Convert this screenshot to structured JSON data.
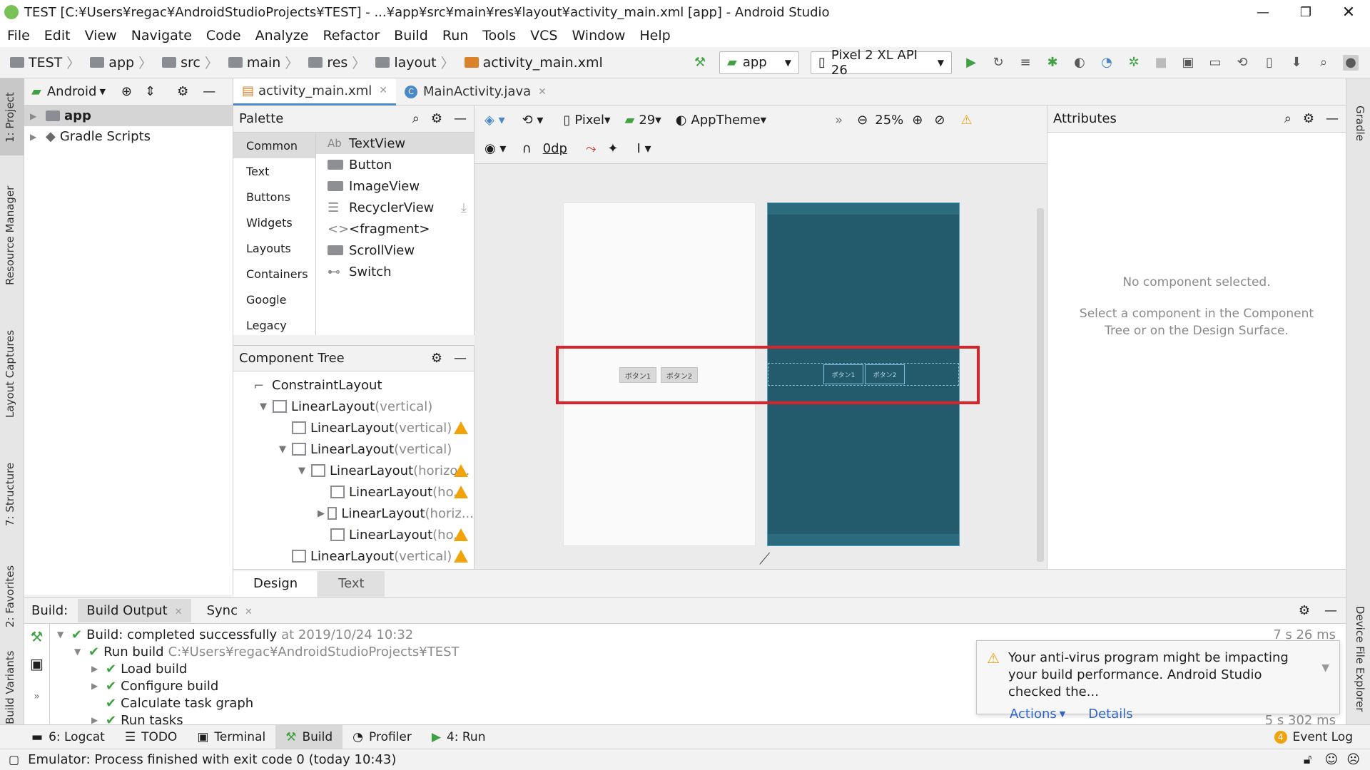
{
  "window": {
    "title": "TEST [C:¥Users¥regac¥AndroidStudioProjects¥TEST] - ...¥app¥src¥main¥res¥layout¥activity_main.xml [app] - Android Studio"
  },
  "menu": [
    "File",
    "Edit",
    "View",
    "Navigate",
    "Code",
    "Analyze",
    "Refactor",
    "Build",
    "Run",
    "Tools",
    "VCS",
    "Window",
    "Help"
  ],
  "breadcrumb": [
    "TEST",
    "app",
    "src",
    "main",
    "res",
    "layout",
    "activity_main.xml"
  ],
  "toolbar": {
    "config": "app",
    "device": "Pixel 2 XL API 26"
  },
  "left_strip": [
    "1: Project",
    "Resource Manager",
    "Layout Captures",
    "7: Structure",
    "2: Favorites",
    "Build Variants"
  ],
  "right_strip": [
    "Gradle",
    "Device File Explorer"
  ],
  "project": {
    "view": "Android",
    "items": [
      "app",
      "Gradle Scripts"
    ]
  },
  "editor_tabs": [
    "activity_main.xml",
    "MainActivity.java"
  ],
  "palette": {
    "title": "Palette",
    "categories": [
      "Common",
      "Text",
      "Buttons",
      "Widgets",
      "Layouts",
      "Containers",
      "Google",
      "Legacy"
    ],
    "widgets": [
      "TextView",
      "Button",
      "ImageView",
      "RecyclerView",
      "<fragment>",
      "ScrollView",
      "Switch"
    ],
    "textview_prefix": "Ab"
  },
  "design_toolbar": {
    "device": "Pixel",
    "api": "29",
    "theme": "AppTheme",
    "zoom": "25%",
    "margin": "0dp"
  },
  "component_tree": {
    "title": "Component Tree",
    "rows": [
      {
        "name": "ConstraintLayout",
        "hint": "",
        "indent": 0,
        "tri": "",
        "warn": false
      },
      {
        "name": "LinearLayout",
        "hint": "(vertical)",
        "indent": 1,
        "tri": "▼",
        "warn": false
      },
      {
        "name": "LinearLayout",
        "hint": "(vertical)",
        "indent": 2,
        "tri": "",
        "warn": true
      },
      {
        "name": "LinearLayout",
        "hint": "(vertical)",
        "indent": 2,
        "tri": "▼",
        "warn": false
      },
      {
        "name": "LinearLayout",
        "hint": "(horizo...",
        "indent": 3,
        "tri": "▼",
        "warn": true
      },
      {
        "name": "LinearLayout",
        "hint": "(ho...",
        "indent": 4,
        "tri": "",
        "warn": true
      },
      {
        "name": "LinearLayout",
        "hint": "(horiz...",
        "indent": 4,
        "tri": "▶",
        "warn": false
      },
      {
        "name": "LinearLayout",
        "hint": "(ho...",
        "indent": 4,
        "tri": "",
        "warn": true
      },
      {
        "name": "LinearLayout",
        "hint": "(vertical)",
        "indent": 2,
        "tri": "",
        "warn": true
      }
    ]
  },
  "preview": {
    "button1": "ボタン1",
    "button2": "ボタン2"
  },
  "attributes": {
    "title": "Attributes",
    "empty": "No component selected.",
    "hint": "Select a component in the Component Tree or on the Design Surface."
  },
  "design_tabs": [
    "Design",
    "Text"
  ],
  "build": {
    "label": "Build:",
    "tabs": [
      "Build Output",
      "Sync"
    ],
    "lines": [
      {
        "text": "Build: completed successfully",
        "extra": "at 2019/10/24 10:32",
        "indent": 0,
        "tri": "▼",
        "time": "7 s 26 ms"
      },
      {
        "text": "Run build",
        "extra": "C:¥Users¥regac¥AndroidStudioProjects¥TEST",
        "indent": 1,
        "tri": "▼",
        "time": ""
      },
      {
        "text": "Load build",
        "extra": "",
        "indent": 2,
        "tri": "▶",
        "time": ""
      },
      {
        "text": "Configure build",
        "extra": "",
        "indent": 2,
        "tri": "▶",
        "time": ""
      },
      {
        "text": "Calculate task graph",
        "extra": "",
        "indent": 2,
        "tri": "",
        "time": ""
      },
      {
        "text": "Run tasks",
        "extra": "",
        "indent": 2,
        "tri": "▶",
        "time": "5 s 302 ms"
      }
    ]
  },
  "notification": {
    "text": "Your anti-virus program might be impacting your build performance. Android Studio checked the...",
    "actions": "Actions",
    "details": "Details"
  },
  "bottom_tabs": [
    "6: Logcat",
    "TODO",
    "Terminal",
    "Build",
    "Profiler",
    "4: Run"
  ],
  "event_log": {
    "count": "4",
    "label": "Event Log"
  },
  "status": "Emulator: Process finished with exit code 0 (today 10:43)"
}
